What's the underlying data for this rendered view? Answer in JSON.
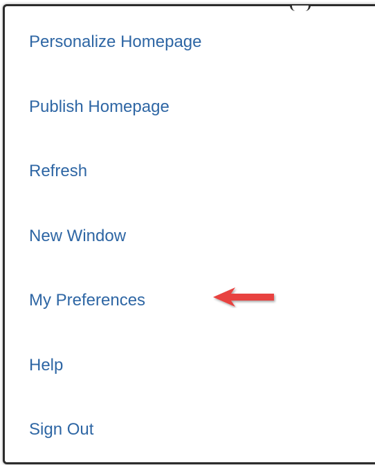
{
  "menu": {
    "items": [
      {
        "label": "Personalize Homepage"
      },
      {
        "label": "Publish Homepage"
      },
      {
        "label": "Refresh"
      },
      {
        "label": "New Window"
      },
      {
        "label": "My Preferences"
      },
      {
        "label": "Help"
      },
      {
        "label": "Sign Out"
      }
    ]
  },
  "colors": {
    "link": "#2e66a4",
    "arrow": "#e8423f",
    "border": "#2b2b2b"
  },
  "icons": {
    "annotation": "red-arrow-icon"
  }
}
